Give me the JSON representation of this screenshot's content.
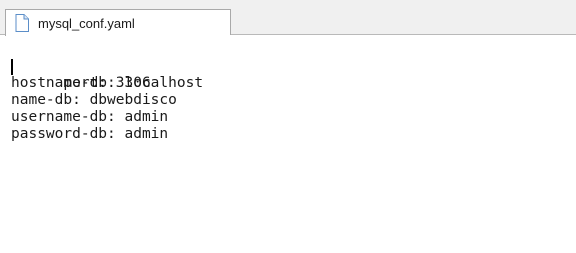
{
  "tab": {
    "icon": "document-icon",
    "label": "mysql_conf.yaml"
  },
  "editor": {
    "lines": [
      "port: 3306",
      "hostname-db: localhost",
      "name-db: dbwebdisco",
      "username-db: admin",
      "password-db: admin"
    ]
  },
  "colors": {
    "tabbar_background": "#f0f0f0",
    "tab_border": "#a9a9a9",
    "icon_blue": "#5b8ec8",
    "text": "#1a1a1a"
  }
}
